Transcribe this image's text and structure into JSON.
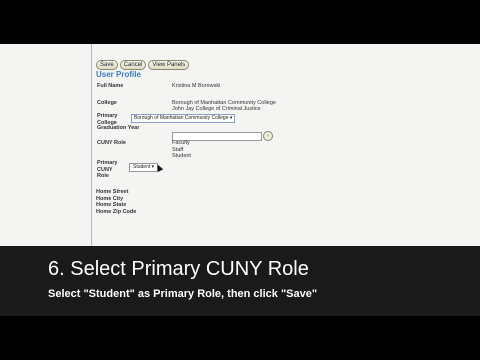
{
  "toolbar": {
    "save": "Save",
    "cancel": "Cancel",
    "view_panels": "View Panels"
  },
  "profile": {
    "section_title": "User Profile",
    "full_name_label": "Full Name",
    "full_name_value": "Kristina M Borowski",
    "college_label": "College",
    "college_values": [
      "Borough of Manhattan Community College",
      "John Jay College of Criminal Justice"
    ],
    "primary_college_label": [
      "Primary",
      "College"
    ],
    "primary_college_value": "Borough of Manhattan Community College",
    "graduation_year_label": "Graduation Year",
    "cuny_role_label": "CUNY Role",
    "cuny_roles": [
      "Faculty",
      "Staff",
      "Student"
    ],
    "primary_role_label": [
      "Primary",
      "CUNY",
      "Role"
    ],
    "primary_role_value": "Student",
    "home_fields": [
      "Home Street",
      "Home City",
      "Home State",
      "Home Zip Code"
    ]
  },
  "caption": {
    "title": "6. Select Primary CUNY Role",
    "subtitle": "Select \"Student\" as Primary Role, then click \"Save\""
  }
}
